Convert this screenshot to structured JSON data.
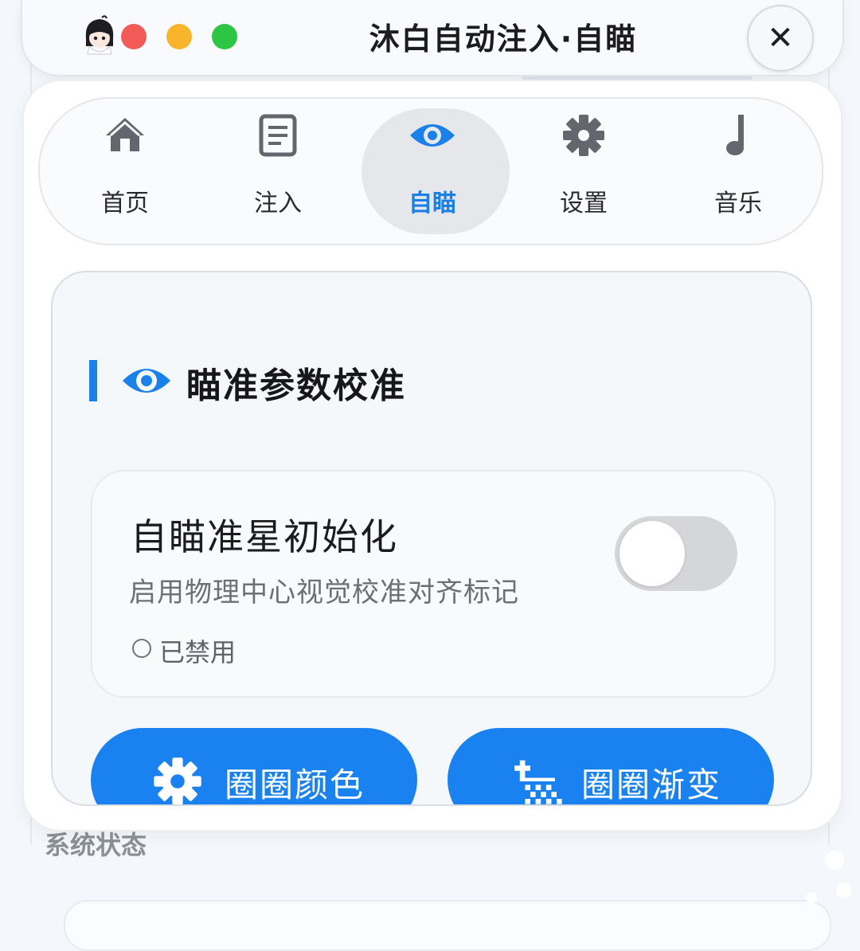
{
  "window": {
    "title": "沐白自动注入·自瞄",
    "close_label": "✕"
  },
  "tabs": [
    {
      "label": "首页",
      "icon": "home-icon"
    },
    {
      "label": "注入",
      "icon": "document-icon"
    },
    {
      "label": "自瞄",
      "icon": "eye-icon",
      "active": true
    },
    {
      "label": "设置",
      "icon": "gear-icon"
    },
    {
      "label": "音乐",
      "icon": "music-note-icon"
    }
  ],
  "section": {
    "title": "瞄准参数校准",
    "icon": "eye-icon"
  },
  "setting": {
    "title": "自瞄准星初始化",
    "description": "启用物理中心视觉校准对齐标记",
    "status": "已禁用",
    "enabled": false
  },
  "buttons": {
    "circle_color": {
      "label": "圈圈颜色",
      "icon": "gear-icon"
    },
    "circle_gradient": {
      "label": "圈圈渐变",
      "icon": "gradient-icon"
    }
  },
  "background": {
    "section_label": "系统状态"
  },
  "colors": {
    "accent": "#1a82f0",
    "traffic_red": "#f25a57",
    "traffic_yellow": "#f8b52c",
    "traffic_green": "#2dc544",
    "toggle_off": "#d5d6da"
  }
}
